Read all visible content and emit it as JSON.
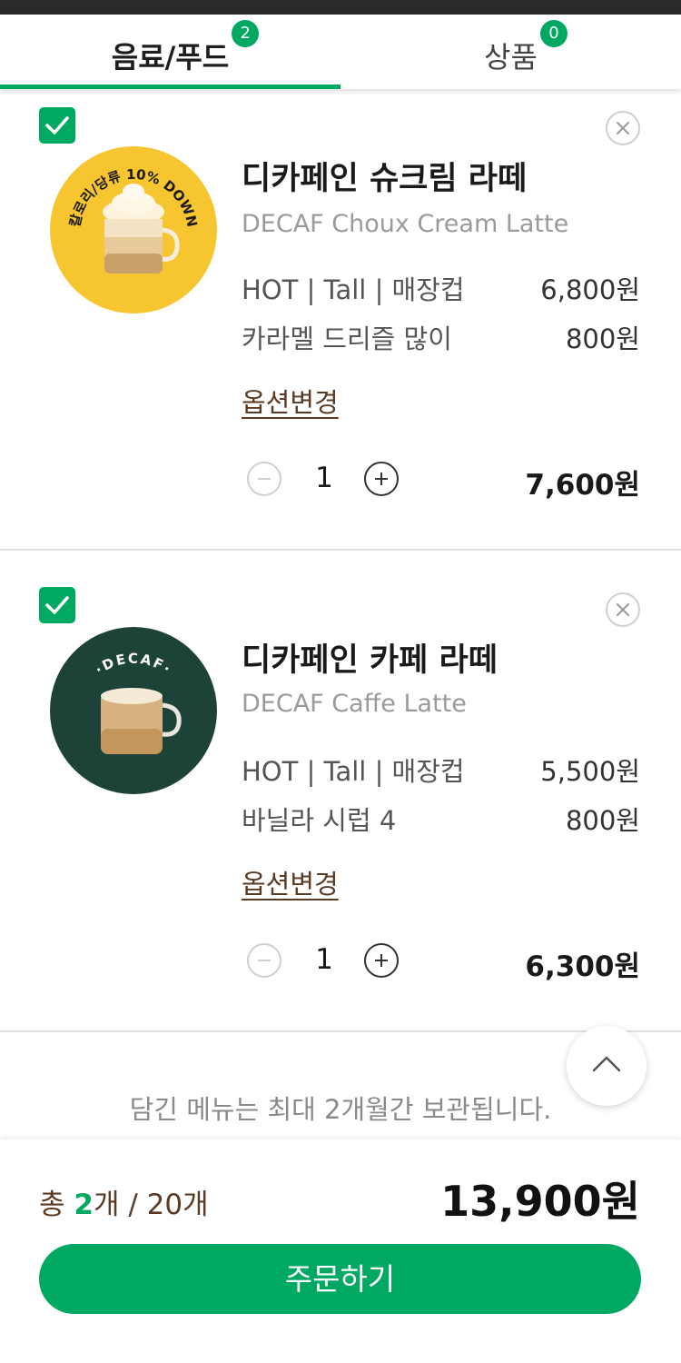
{
  "tabs": {
    "drinks_food": {
      "label": "음료/푸드",
      "badge": "2"
    },
    "goods": {
      "label": "상품",
      "badge": "0"
    }
  },
  "items": [
    {
      "name_ko": "디카페인 슈크림 라떼",
      "name_en": "DECAF Choux Cream Latte",
      "thumb_text": "칼로리/당류 10% DOWN",
      "options": [
        {
          "label": "HOT | Tall | 매장컵",
          "price": "6,800원"
        },
        {
          "label": "카라멜 드리즐 많이",
          "price": "800원"
        }
      ],
      "change_label": "옵션변경",
      "quantity": "1",
      "line_total": "7,600원"
    },
    {
      "name_ko": "디카페인 카페 라떼",
      "name_en": "DECAF Caffe Latte",
      "thumb_text": "·DECAF·",
      "options": [
        {
          "label": "HOT | Tall | 매장컵",
          "price": "5,500원"
        },
        {
          "label": "바닐라 시럽 4",
          "price": "800원"
        }
      ],
      "change_label": "옵션변경",
      "quantity": "1",
      "line_total": "6,300원"
    }
  ],
  "notice": "담긴 메뉴는 최대 2개월간 보관됩니다.",
  "summary": {
    "prefix": "총 ",
    "count": "2",
    "suffix": "개 / 20개",
    "total": "13,900원"
  },
  "order_button": "주문하기",
  "colors": {
    "accent": "#00a862",
    "brown": "#5a3a22"
  },
  "icons": {
    "check": "check-icon",
    "remove": "close-icon",
    "minus": "minus-icon",
    "plus": "plus-icon",
    "scroll_top": "chevron-up-icon"
  }
}
